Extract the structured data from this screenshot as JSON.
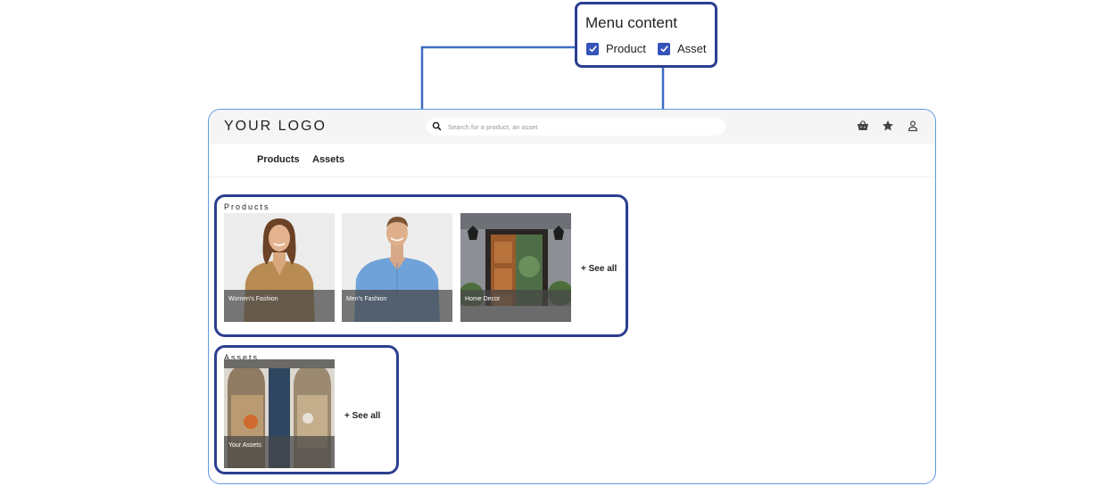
{
  "menu_content": {
    "title": "Menu content",
    "options": [
      {
        "label": "Product",
        "checked": true
      },
      {
        "label": "Asset",
        "checked": true
      }
    ]
  },
  "header": {
    "logo": "YOUR LOGO",
    "search_placeholder": "Search for a product, an asset",
    "icons": [
      "basket-icon",
      "star-icon",
      "user-icon"
    ]
  },
  "nav": {
    "items": [
      {
        "label": "Products"
      },
      {
        "label": "Assets"
      }
    ]
  },
  "products_section": {
    "title": "Products",
    "cards": [
      {
        "label": "Women's Fashion",
        "image": "woman-in-blouse"
      },
      {
        "label": "Men's Fashion",
        "image": "man-in-blue-shirt"
      },
      {
        "label": "Home Decor",
        "image": "wooden-door"
      }
    ],
    "see_all": "See all"
  },
  "assets_section": {
    "title": "Assets",
    "cards": [
      {
        "label": "Your Assets",
        "image": "storefront-window"
      }
    ],
    "see_all": "See all"
  },
  "colors": {
    "callout_border": "#2b3f8f",
    "checkbox": "#3553b8",
    "frame_border": "#5a9be0",
    "connector": "#3d6cc4"
  }
}
